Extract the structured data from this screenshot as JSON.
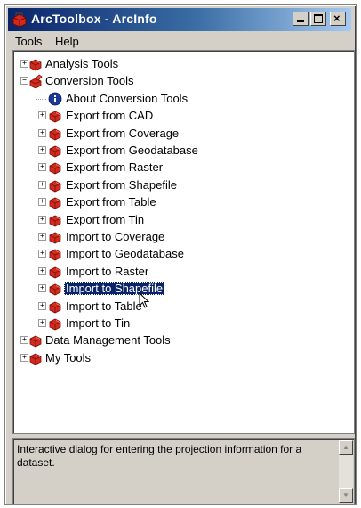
{
  "window": {
    "title": "ArcToolbox - ArcInfo",
    "buttons": {
      "minimize": "_",
      "maximize": "□",
      "close": "×"
    }
  },
  "menu": {
    "tools": "Tools",
    "help": "Help"
  },
  "tree": [
    {
      "label": "Analysis Tools",
      "expander": "+",
      "icon": "toolbox-icon",
      "level": 0
    },
    {
      "label": "Conversion Tools",
      "expander": "−",
      "icon": "open-toolbox-icon",
      "level": 0
    },
    {
      "label": "About Conversion Tools",
      "expander": "",
      "icon": "info-icon",
      "level": 1
    },
    {
      "label": "Export from CAD",
      "expander": "+",
      "icon": "toolbox-icon",
      "level": 1
    },
    {
      "label": "Export from Coverage",
      "expander": "+",
      "icon": "toolbox-icon",
      "level": 1
    },
    {
      "label": "Export from Geodatabase",
      "expander": "+",
      "icon": "toolbox-icon",
      "level": 1
    },
    {
      "label": "Export from Raster",
      "expander": "+",
      "icon": "toolbox-icon",
      "level": 1
    },
    {
      "label": "Export from Shapefile",
      "expander": "+",
      "icon": "toolbox-icon",
      "level": 1
    },
    {
      "label": "Export from Table",
      "expander": "+",
      "icon": "toolbox-icon",
      "level": 1
    },
    {
      "label": "Export from Tin",
      "expander": "+",
      "icon": "toolbox-icon",
      "level": 1
    },
    {
      "label": "Import to Coverage",
      "expander": "+",
      "icon": "toolbox-icon",
      "level": 1
    },
    {
      "label": "Import to Geodatabase",
      "expander": "+",
      "icon": "toolbox-icon",
      "level": 1
    },
    {
      "label": "Import to Raster",
      "expander": "+",
      "icon": "toolbox-icon",
      "level": 1
    },
    {
      "label": "Import to Shapefile",
      "expander": "+",
      "icon": "toolbox-icon",
      "level": 1,
      "selected": true
    },
    {
      "label": "Import to Table",
      "expander": "+",
      "icon": "toolbox-icon",
      "level": 1
    },
    {
      "label": "Import to Tin",
      "expander": "+",
      "icon": "toolbox-icon",
      "level": 1
    },
    {
      "label": "Data Management Tools",
      "expander": "+",
      "icon": "toolbox-icon",
      "level": 0
    },
    {
      "label": "My Tools",
      "expander": "+",
      "icon": "toolbox-icon",
      "level": 0
    }
  ],
  "description": "Interactive dialog for entering the projection information for a dataset.",
  "colors": {
    "title_start": "#0a246a",
    "title_end": "#a6caf0",
    "toolbox_red": "#cc2a1e",
    "selection": "#0a246a"
  }
}
